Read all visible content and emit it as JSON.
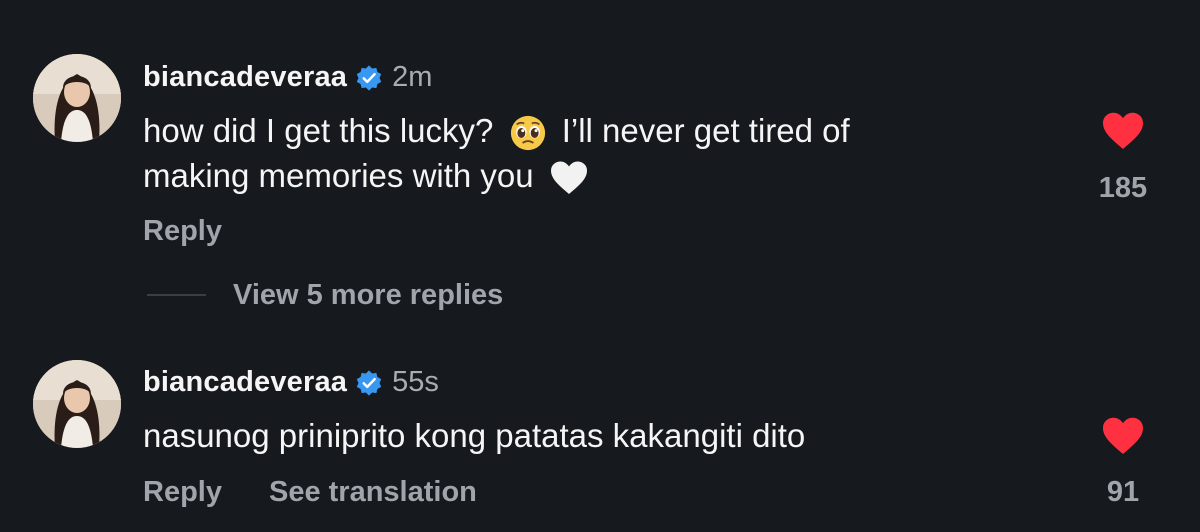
{
  "comments": [
    {
      "username": "biancadeveraa",
      "time": "2m",
      "text_part1": "how did I get this lucky?",
      "emoji1": "pleading-face",
      "text_part2": "I’ll never get tired of",
      "text_line2": "making memories with you",
      "emoji2": "white-heart",
      "reply_label": "Reply",
      "like_count": "185"
    },
    {
      "username": "biancadeveraa",
      "time": "55s",
      "text": "nasunog priniprito kong patatas kakangiti dito",
      "reply_label": "Reply",
      "translate_label": "See translation",
      "like_count": "91"
    }
  ],
  "view_replies_label": "View 5 more replies",
  "colors": {
    "background": "#16191e",
    "text_primary": "#f5f5f5",
    "text_secondary": "#a0a4ab",
    "like_red": "#ff3040",
    "verified_blue": "#3897f0"
  },
  "icons": {
    "verified": "verified-badge-icon",
    "like": "heart-filled-icon"
  }
}
